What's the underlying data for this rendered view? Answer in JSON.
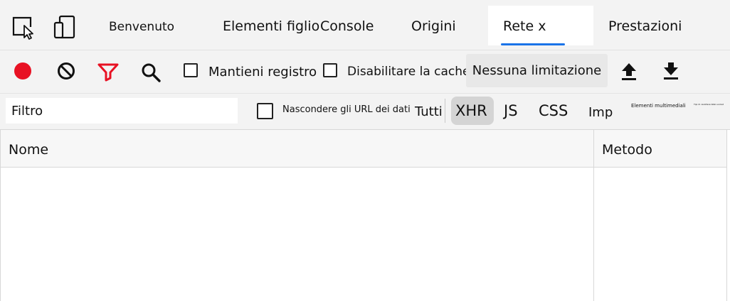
{
  "tabs": [
    {
      "label": "Benvenuto"
    },
    {
      "label": "Elementi figlio"
    },
    {
      "label": "Console"
    },
    {
      "label": "Origini"
    },
    {
      "label": "Rete x",
      "active": true
    },
    {
      "label": "Prestazioni"
    }
  ],
  "toolbar": {
    "icons": [
      "inspect-icon",
      "device-toggle-icon",
      "record-icon",
      "clear-icon",
      "filter-icon",
      "search-icon",
      "upload-icon",
      "download-icon"
    ],
    "preserve_log": {
      "label": "Mantieni registro",
      "checked": false
    },
    "disable_cache": {
      "label": "Disabilitare la cache",
      "checked": false
    },
    "throttling": "Nessuna limitazione"
  },
  "filter": {
    "placeholder": "Filtro",
    "hide_data_urls": {
      "label": "Nascondere gli URL dei dati",
      "checked": false
    },
    "types": [
      {
        "label": "Tutti"
      },
      {
        "label": "XHR",
        "selected": true
      },
      {
        "label": "JS"
      },
      {
        "label": "CSS"
      },
      {
        "label": "Imp"
      },
      {
        "label": "Elementi multimediali"
      },
      {
        "label": "Tipi di carattere Web socket"
      }
    ]
  },
  "table": {
    "columns": [
      "Nome",
      "Metodo"
    ]
  },
  "colors": {
    "record": "#e81123",
    "filter": "#e81123",
    "accent": "#1a73e8",
    "toolbar_bg": "#f3f3f3"
  }
}
